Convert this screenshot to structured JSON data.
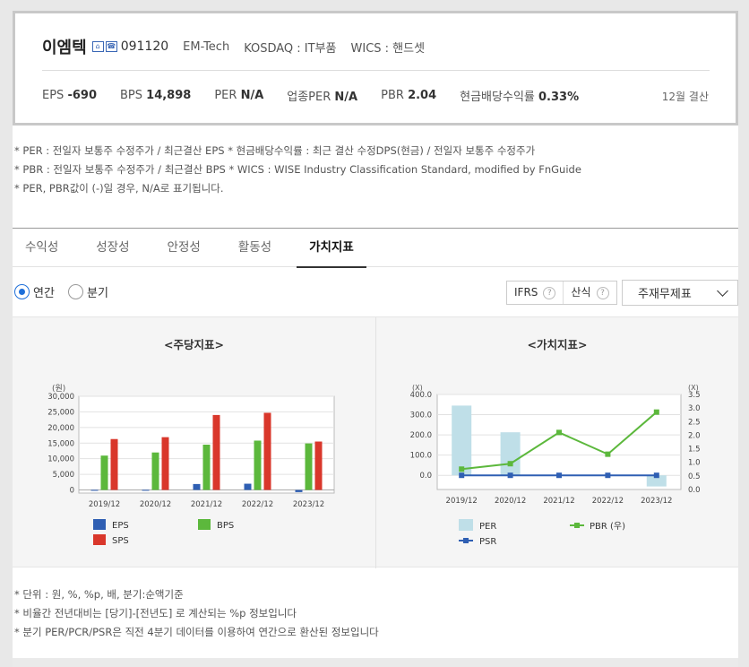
{
  "company": {
    "name": "이엠텍",
    "code": "091120",
    "english_name": "EM-Tech",
    "market": "KOSDAQ : IT부품",
    "wics": "WICS : 핸드셋"
  },
  "metrics": {
    "eps_label": "EPS",
    "eps_value": "-690",
    "bps_label": "BPS",
    "bps_value": "14,898",
    "per_label": "PER",
    "per_value": "N/A",
    "industry_per_label": "업종PER",
    "industry_per_value": "N/A",
    "pbr_label": "PBR",
    "pbr_value": "2.04",
    "dividend_label": "현금배당수익률",
    "dividend_value": "0.33%",
    "settlement": "12월 결산"
  },
  "notes_top": [
    "* PER : 전일자 보통주 수정주가 / 최근결산 EPS * 현금배당수익률 : 최근 결산 수정DPS(현금) / 전일자 보통주 수정주가",
    "* PBR : 전일자 보통주 수정주가 / 최근결산 BPS * WICS : WISE Industry Classification Standard, modified by FnGuide",
    "* PER, PBR값이 (-)일 경우, N/A로 표기됩니다."
  ],
  "tabs": [
    "수익성",
    "성장성",
    "안정성",
    "활동성",
    "가치지표"
  ],
  "controls": {
    "radio_annual": "연간",
    "radio_quarter": "분기",
    "ifrs": "IFRS",
    "calc": "산식",
    "qmark": "?",
    "select": "주재무제표"
  },
  "chart_data": [
    {
      "type": "bar",
      "title": "<주당지표>",
      "unit_label": "(원)",
      "categories": [
        "2019/12",
        "2020/12",
        "2021/12",
        "2022/12",
        "2023/12"
      ],
      "series": [
        {
          "name": "EPS",
          "color": "#2f5fb3",
          "values": [
            30,
            40,
            1900,
            2000,
            -690
          ]
        },
        {
          "name": "BPS",
          "color": "#5cb83c",
          "values": [
            11000,
            12000,
            14500,
            15800,
            14898
          ]
        },
        {
          "name": "SPS",
          "color": "#d9372b",
          "values": [
            16300,
            16900,
            24000,
            24700,
            15500
          ]
        }
      ],
      "yticks": [
        "30,000",
        "25,000",
        "20,000",
        "15,000",
        "10,000",
        "5,000",
        "0"
      ],
      "ylim": [
        -1000,
        30000
      ]
    },
    {
      "type": "bar+line",
      "title": "<가치지표>",
      "unit_left": "(X)",
      "unit_right": "(X)",
      "categories": [
        "2019/12",
        "2020/12",
        "2021/12",
        "2022/12",
        "2023/12"
      ],
      "series": [
        {
          "name": "PER",
          "kind": "bar",
          "axis": "left",
          "color": "#bfdfe8",
          "values": [
            345,
            213,
            0,
            0,
            -55
          ]
        },
        {
          "name": "PBR (우)",
          "kind": "line",
          "axis": "right",
          "color": "#5cb83c",
          "values": [
            0.75,
            0.95,
            2.1,
            1.3,
            2.85
          ]
        },
        {
          "name": "PSR",
          "kind": "line",
          "axis": "left",
          "color": "#2f5fb3",
          "values": [
            0,
            0,
            0,
            0,
            0
          ]
        }
      ],
      "yticks_left": [
        "400.0",
        "300.0",
        "200.0",
        "100.0",
        "0.0"
      ],
      "ylim_left": [
        -70,
        400
      ],
      "yticks_right": [
        "3.5",
        "3.0",
        "2.5",
        "2.0",
        "1.5",
        "1.0",
        "0.5",
        "0.0"
      ],
      "ylim_right": [
        0,
        3.5
      ]
    }
  ],
  "notes_bottom": [
    "* 단위 : 원, %, %p, 배, 분기:순액기준",
    "* 비율간 전년대비는 [당기]-[전년도] 로 계산되는 %p 정보입니다",
    "* 분기 PER/PCR/PSR은 직전 4분기 데이터를 이용하여 연간으로 환산된 정보입니다"
  ]
}
